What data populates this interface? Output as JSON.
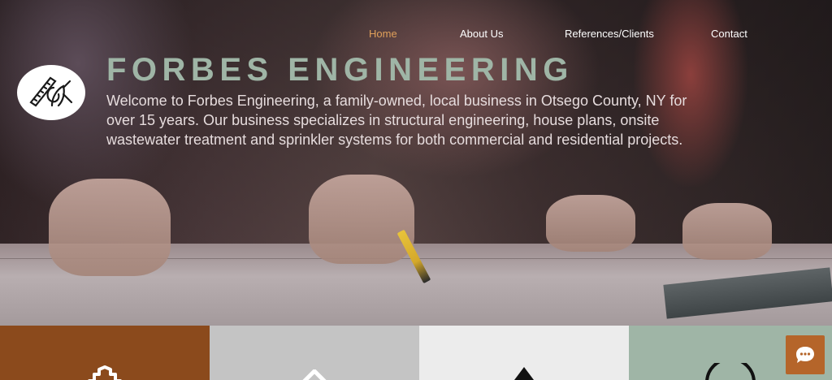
{
  "nav": {
    "items": [
      {
        "label": "Home",
        "active": true
      },
      {
        "label": "About Us",
        "active": false
      },
      {
        "label": "References/Clients",
        "active": false
      },
      {
        "label": "Contact",
        "active": false
      }
    ],
    "active_color": "#e0a05a"
  },
  "header": {
    "logo_icon": "compass-ruler-logo",
    "title": "FORBES ENGINEERING",
    "title_color": "#9fb5a6",
    "intro": "Welcome to Forbes Engineering, a family-owned, local business in Otsego County, NY for over 15 years.  Our business specializes in structural engineering, house plans, onsite wastewater treatment and sprinkler systems for both commercial and residential projects."
  },
  "tiles": [
    {
      "icon": "gear-icon",
      "color": "#8b4a1c"
    },
    {
      "icon": "diamond-icon",
      "color": "#c4c4c4"
    },
    {
      "icon": "triangle-icon",
      "color": "#ececec"
    },
    {
      "icon": "circle-icon",
      "color": "#9fb5a6"
    }
  ],
  "chat": {
    "icon": "chat-bubble-icon",
    "color": "#b5652a"
  }
}
